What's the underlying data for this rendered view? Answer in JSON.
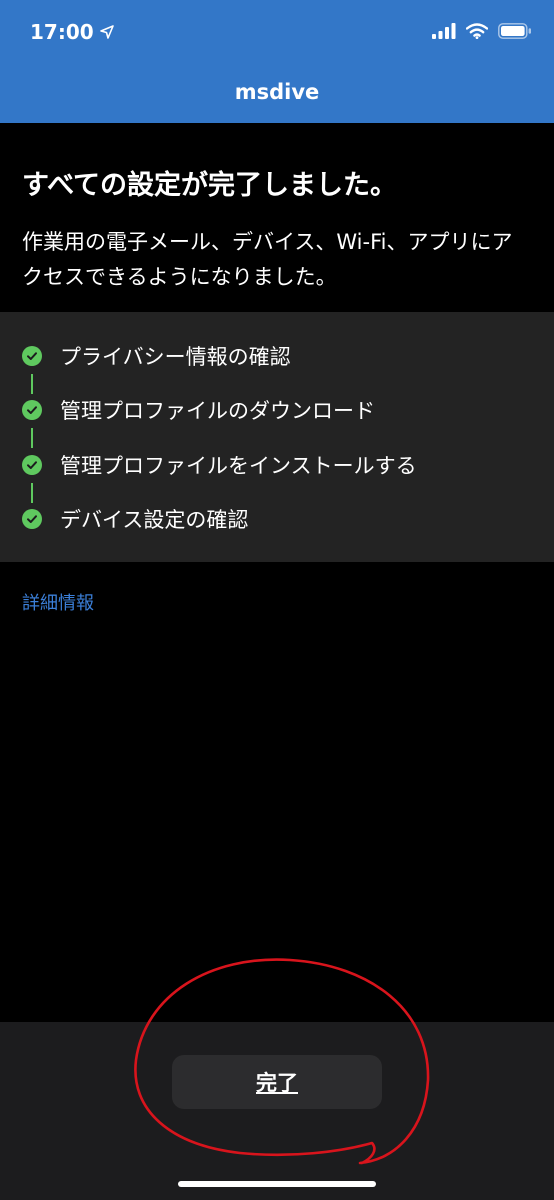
{
  "status_bar": {
    "time": "17:00",
    "location_icon": "location-arrow-icon",
    "signal_icon": "cellular-signal-icon",
    "wifi_icon": "wifi-icon",
    "battery_icon": "battery-icon"
  },
  "nav": {
    "title": "msdive"
  },
  "intro": {
    "title": "すべての設定が完了しました。",
    "description": "作業用の電子メール、デバイス、Wi-Fi、アプリにアクセスできるようになりました。"
  },
  "steps": [
    {
      "label": "プライバシー情報の確認",
      "status": "complete"
    },
    {
      "label": "管理プロファイルのダウンロード",
      "status": "complete"
    },
    {
      "label": "管理プロファイルをインストールする",
      "status": "complete"
    },
    {
      "label": "デバイス設定の確認",
      "status": "complete"
    }
  ],
  "details_link": "詳細情報",
  "footer": {
    "done_label": "完了"
  },
  "colors": {
    "header": "#3377c8",
    "check": "#5fc95f",
    "link": "#3b7fd8",
    "annotation": "#d8141c"
  }
}
